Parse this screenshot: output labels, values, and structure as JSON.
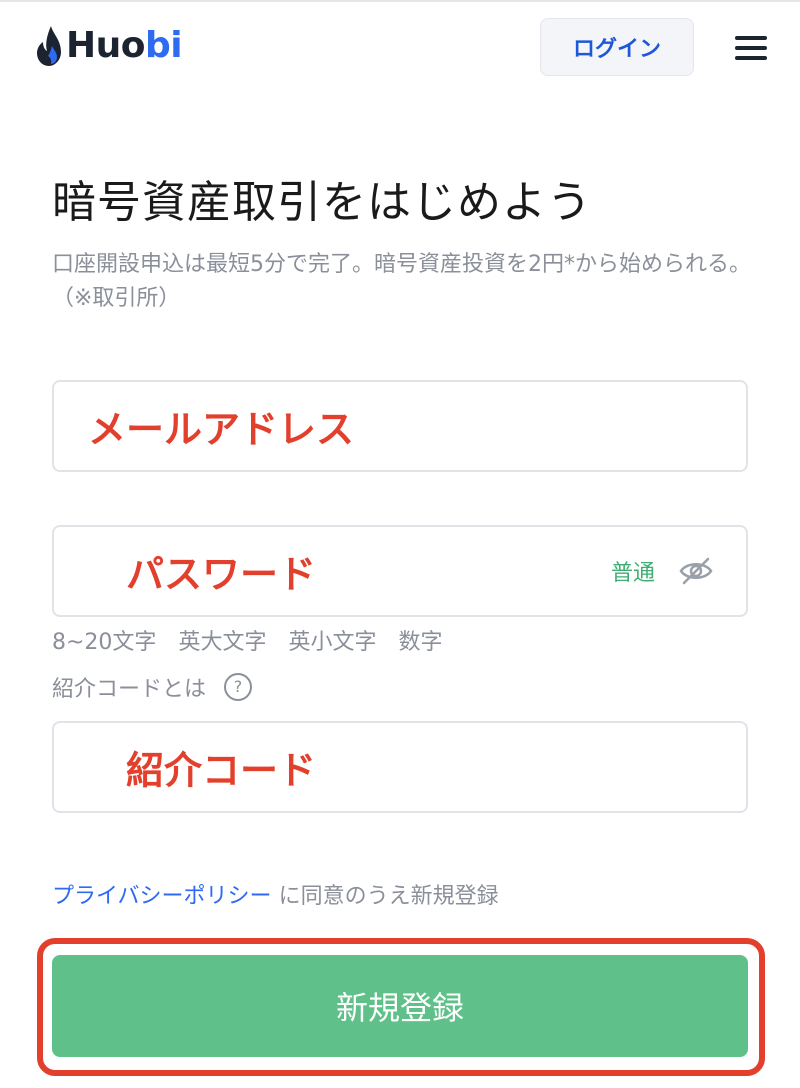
{
  "header": {
    "logo_prefix": "Huo",
    "logo_suffix": "bi",
    "login_label": "ログイン"
  },
  "main": {
    "title": "暗号資産取引をはじめよう",
    "subtitle": "口座開設申込は最短5分で完了。暗号資産投資を2円*から始められる。（※取引所）"
  },
  "form": {
    "email_label": "メールアドレス",
    "password_label": "パスワード",
    "password_strength": "普通",
    "password_hints": [
      "8~20文字",
      "英大文字",
      "英小文字",
      "数字"
    ],
    "referral_question": "紹介コードとは",
    "referral_help_icon": "?",
    "referral_label": "紹介コード"
  },
  "footer": {
    "privacy_link": "プライバシーポリシー",
    "privacy_text": "に同意のうえ新規登録",
    "register_label": "新規登録"
  },
  "colors": {
    "brand_blue": "#2e6bf2",
    "annotation_red": "#e2402c",
    "register_green": "#5fc189",
    "strength_green": "#3fae74"
  },
  "icons": {
    "logo": "flame-logo-icon",
    "menu": "hamburger-menu-icon",
    "visibility": "eye-off-icon",
    "help": "question-circle-icon"
  }
}
